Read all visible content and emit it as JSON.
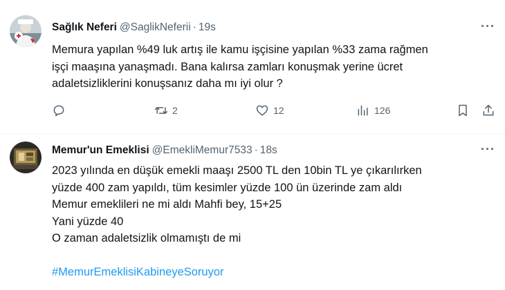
{
  "tweets": [
    {
      "name": "Sağlık Neferi",
      "handle": "@SaglikNeferii",
      "dot": "·",
      "time": "19s",
      "more": "···",
      "lines": [
        "Memura yapılan %49 luk artış ile kamu işçisine yapılan %33 zama rağmen",
        "işçi maaşına yanaşmadı. Bana kalırsa zamları konuşmak yerine ücret",
        "adaletsizliklerini konuşsanız daha mı iyi olur ?"
      ],
      "actions": {
        "reply_icon": "reply-icon",
        "retweet_icon": "retweet-icon",
        "retweets": "2",
        "like_icon": "heart-icon",
        "likes": "12",
        "views_icon": "views-chart-icon",
        "views": "126",
        "bookmark_icon": "bookmark-icon",
        "share_icon": "share-icon"
      }
    },
    {
      "name": "Memur'un Emeklisi",
      "handle": "@EmekliMemur7533",
      "dot": "·",
      "time": "18s",
      "more": "···",
      "lines": [
        "2023 yılında en düşük emekli maaşı 2500 TL den 10bin TL ye çıkarılırken",
        "yüzde 400 zam yapıldı, tüm kesimler yüzde 100 ün üzerinde zam aldı",
        "Memur emeklileri ne mi aldı Mahfi bey, 15+25",
        "Yani yüzde 40",
        "O zaman adaletsizlik olmamıştı de mi"
      ],
      "hashtag": "#MemurEmeklisiKabineyeSoruyor"
    }
  ],
  "colors": {
    "text": "#0f1419",
    "secondary": "#536471",
    "link": "#1d9bf0",
    "divider": "#eff3f4"
  }
}
